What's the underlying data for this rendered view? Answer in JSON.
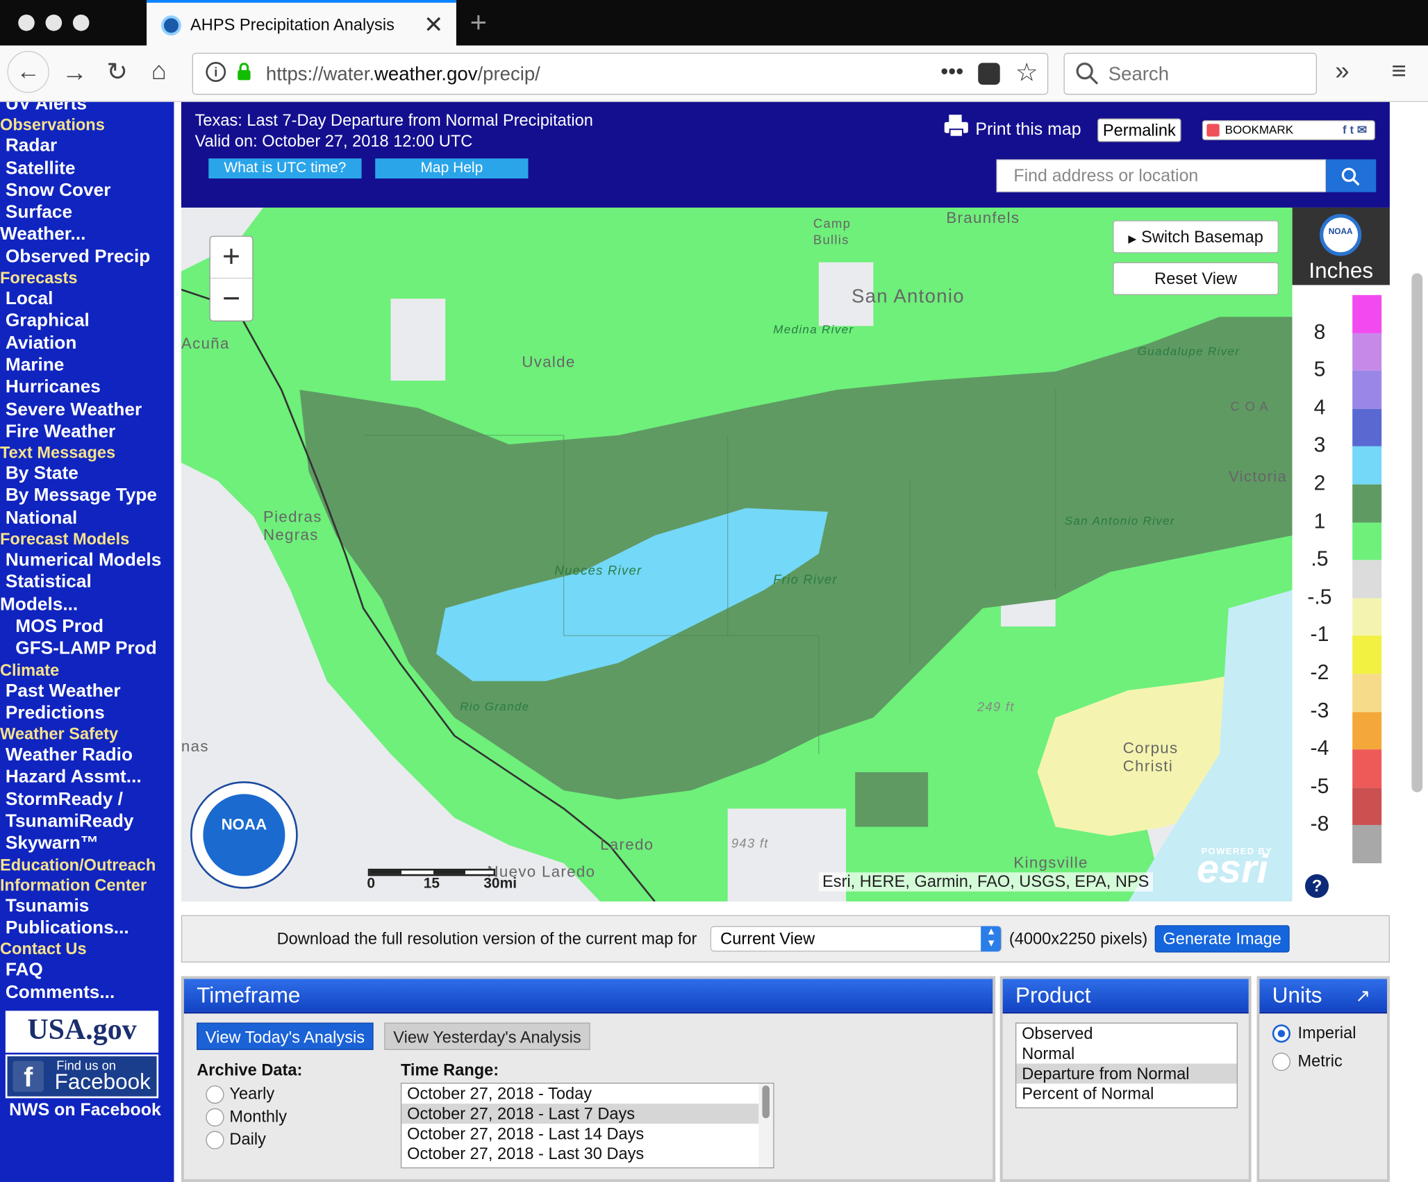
{
  "browser": {
    "tab_title": "AHPS Precipitation Analysis",
    "url_prefix": "https://water.",
    "url_domain": "weather.gov",
    "url_path": "/precip/",
    "search_placeholder": "Search"
  },
  "sidebar": {
    "items": [
      {
        "label": "UV Alerts",
        "kind": "item"
      },
      {
        "label": "Observations",
        "kind": "head"
      },
      {
        "label": "Radar",
        "kind": "item"
      },
      {
        "label": "Satellite",
        "kind": "item"
      },
      {
        "label": "Snow Cover",
        "kind": "item"
      },
      {
        "label": "Surface",
        "kind": "item"
      },
      {
        "label": "Weather...",
        "kind": "flush"
      },
      {
        "label": "Observed Precip",
        "kind": "item"
      },
      {
        "label": "Forecasts",
        "kind": "head"
      },
      {
        "label": "Local",
        "kind": "item"
      },
      {
        "label": "Graphical",
        "kind": "item"
      },
      {
        "label": "Aviation",
        "kind": "item"
      },
      {
        "label": "Marine",
        "kind": "item"
      },
      {
        "label": "Hurricanes",
        "kind": "item"
      },
      {
        "label": "Severe Weather",
        "kind": "item"
      },
      {
        "label": "Fire Weather",
        "kind": "item"
      },
      {
        "label": "Text Messages",
        "kind": "head"
      },
      {
        "label": "By State",
        "kind": "item"
      },
      {
        "label": "By Message Type",
        "kind": "item"
      },
      {
        "label": "National",
        "kind": "item"
      },
      {
        "label": "Forecast Models",
        "kind": "head"
      },
      {
        "label": "Numerical Models",
        "kind": "item"
      },
      {
        "label": "Statistical",
        "kind": "item"
      },
      {
        "label": "Models...",
        "kind": "flush"
      },
      {
        "label": "MOS Prod",
        "kind": "sub"
      },
      {
        "label": "GFS-LAMP Prod",
        "kind": "sub"
      },
      {
        "label": "Climate",
        "kind": "head"
      },
      {
        "label": "Past Weather",
        "kind": "item"
      },
      {
        "label": "Predictions",
        "kind": "item"
      },
      {
        "label": "Weather Safety",
        "kind": "head"
      },
      {
        "label": "Weather Radio",
        "kind": "item"
      },
      {
        "label": "Hazard Assmt...",
        "kind": "item"
      },
      {
        "label": "StormReady /",
        "kind": "item"
      },
      {
        "label": "TsunamiReady",
        "kind": "item"
      },
      {
        "label": "Skywarn™",
        "kind": "item"
      },
      {
        "label": "Education/Outreach",
        "kind": "head"
      },
      {
        "label": "Information Center",
        "kind": "head"
      },
      {
        "label": "Tsunamis",
        "kind": "item"
      },
      {
        "label": "Publications...",
        "kind": "item"
      },
      {
        "label": "Contact Us",
        "kind": "head"
      },
      {
        "label": "FAQ",
        "kind": "item"
      },
      {
        "label": "Comments...",
        "kind": "item"
      }
    ],
    "usagov_label": "USA.gov",
    "facebook_small": "Find us on",
    "facebook_big": "Facebook",
    "facebook_caption": "NWS on Facebook"
  },
  "header": {
    "title": "Texas: Last 7-Day Departure from Normal Precipitation",
    "valid": "Valid on: October 27, 2018 12:00 UTC",
    "utc_button": "What is UTC time?",
    "help_button": "Map Help",
    "print_label": "Print this map",
    "permalink_label": "Permalink",
    "bookmark_label": "BOOKMARK",
    "find_placeholder": "Find address or location"
  },
  "map": {
    "switch_basemap": "Switch Basemap",
    "reset_view": "Reset View",
    "zoom_in": "+",
    "zoom_out": "−",
    "places": {
      "braunfels": "Braunfels",
      "camp_bullis": "Camp Bullis",
      "san_antonio": "San Antonio",
      "acuna": "Acuña",
      "uvalde": "Uvalde",
      "medina_river": "Medina River",
      "guadalupe_river": "Guadalupe River",
      "victoria": "Victoria",
      "piedras_negras": "Piedras Negras",
      "nueces_river": "Nueces River",
      "frio_river": "Frio River",
      "san_antonio_river": "San Antonio River",
      "rio_grande": "Rio Grande",
      "elev_249": "249 ft",
      "corpus_christi": "Corpus Christi",
      "laredo": "Laredo",
      "elev_943": "943 ft",
      "nuevo_laredo": "Nuevo Laredo",
      "kingsville": "Kingsville",
      "nas": "nas",
      "coa": "C O A"
    },
    "noaa_label": "NOAA",
    "scale_labels": [
      "0",
      "15",
      "30mi"
    ],
    "attribution": "Esri, HERE, Garmin, FAO, USGS, EPA, NPS",
    "esri_powered": "POWERED BY",
    "esri_label": "esri"
  },
  "legend": {
    "units_label": "Inches",
    "noaa_label": "NOAA",
    "help_label": "?",
    "labels": [
      "8",
      "5",
      "4",
      "3",
      "2",
      "1",
      ".5",
      "-.5",
      "-1",
      "-2",
      "-3",
      "-4",
      "-5",
      "-8"
    ],
    "colors": [
      "#f24af0",
      "#c58ae8",
      "#9a86e6",
      "#5a68d2",
      "#74d8f8",
      "#5f9a63",
      "#6ef07a",
      "#dcdcdc",
      "#f4f4b0",
      "#f2f040",
      "#f6dc8a",
      "#f4a83a",
      "#ee5a58",
      "#cc5050",
      "#a8a8a8"
    ]
  },
  "download": {
    "label": "Download the full resolution version of the current map for",
    "select_value": "Current View",
    "pixels": "(4000x2250 pixels)",
    "button": "Generate Image"
  },
  "timeframe": {
    "title": "Timeframe",
    "today_button": "View Today's Analysis",
    "yesterday_button": "View Yesterday's Analysis",
    "archive_label": "Archive Data:",
    "archive_options": [
      "Yearly",
      "Monthly",
      "Daily"
    ],
    "range_label": "Time Range:",
    "ranges": [
      "October 27, 2018 - Today",
      "October 27, 2018 - Last 7 Days",
      "October 27, 2018 - Last 14 Days",
      "October 27, 2018 - Last 30 Days"
    ],
    "selected_range": 1
  },
  "product": {
    "title": "Product",
    "options": [
      "Observed",
      "Normal",
      "Departure from Normal",
      "Percent of Normal"
    ],
    "selected": 2
  },
  "units": {
    "title": "Units",
    "options": [
      "Imperial",
      "Metric"
    ],
    "selected": 0
  }
}
